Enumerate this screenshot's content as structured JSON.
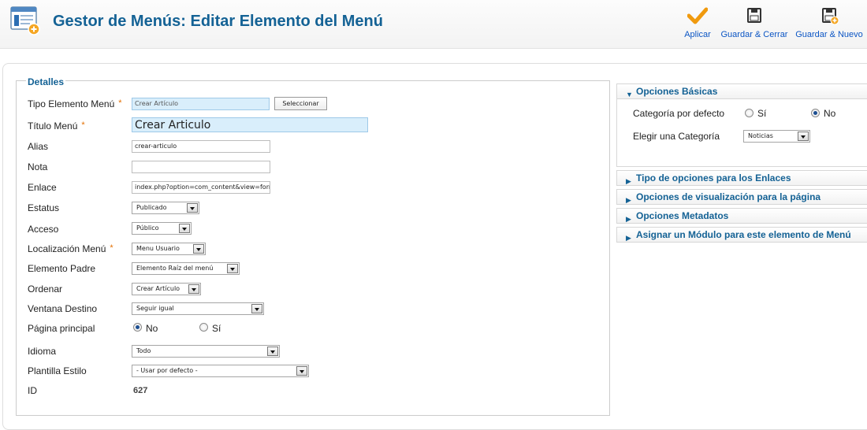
{
  "header": {
    "title": "Gestor de Menús: Editar Elemento del Menú",
    "icon": "menu-manager-icon"
  },
  "toolbar": {
    "apply_label": "Aplicar",
    "save_close_label": "Guardar & Cerrar",
    "save_new_label": "Guardar & Nuevo"
  },
  "details": {
    "legend": "Detalles",
    "fields": {
      "tipo": {
        "label": "Tipo Elemento Menú",
        "value": "Crear Artículo",
        "button": "Seleccionar"
      },
      "titulo": {
        "label": "Título Menú",
        "value": "Crear Articulo"
      },
      "alias": {
        "label": "Alias",
        "value": "crear-articulo"
      },
      "nota": {
        "label": "Nota",
        "value": ""
      },
      "enlace": {
        "label": "Enlace",
        "value": "index.php?option=com_content&view=form&lay"
      },
      "estatus": {
        "label": "Estatus",
        "value": "Publicado"
      },
      "acceso": {
        "label": "Acceso",
        "value": "Público"
      },
      "localizacion": {
        "label": "Localización Menú",
        "value": "Menu Usuario"
      },
      "padre": {
        "label": "Elemento Padre",
        "value": "Elemento Raíz del menú"
      },
      "ordenar": {
        "label": "Ordenar",
        "value": "Crear Artículo"
      },
      "ventana": {
        "label": "Ventana Destino",
        "value": "Seguir igual"
      },
      "pagina_principal": {
        "label": "Página principal",
        "option_no": "No",
        "option_si": "Sí",
        "selected": "No"
      },
      "idioma": {
        "label": "Idioma",
        "value": "Todo"
      },
      "plantilla": {
        "label": "Plantilla Estilo",
        "value": "- Usar por defecto -"
      },
      "id": {
        "label": "ID",
        "value": "627"
      }
    },
    "required_marker": "*"
  },
  "sidebar": {
    "basic": {
      "title": "Opciones Básicas",
      "categoria_defecto": {
        "label": "Categoría por defecto",
        "option_si": "Sí",
        "option_no": "No",
        "selected": "No"
      },
      "elegir_categoria": {
        "label": "Elegir una Categoría",
        "value": "Noticias"
      }
    },
    "sections": [
      {
        "title": "Tipo de opciones para los Enlaces"
      },
      {
        "title": "Opciones de visualización para la página"
      },
      {
        "title": "Opciones Metadatos"
      },
      {
        "title": "Asignar un Módulo para este elemento de Menú"
      }
    ]
  },
  "colors": {
    "title_blue": "#146295",
    "link_blue": "#0b55c4",
    "required_orange": "#e36e00",
    "input_highlight": "#d9eefb"
  }
}
